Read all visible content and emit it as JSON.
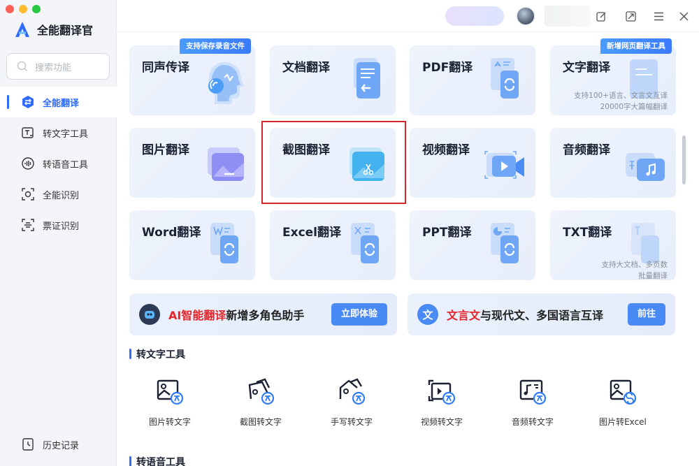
{
  "app": {
    "name": "全能翻译官",
    "brand_color": "#2f6bff"
  },
  "sidebar": {
    "search_placeholder": "搜索功能",
    "items": [
      {
        "label": "全能翻译",
        "icon": "translate-icon",
        "active": true
      },
      {
        "label": "转文字工具",
        "icon": "text-convert-icon"
      },
      {
        "label": "转语音工具",
        "icon": "voice-icon"
      },
      {
        "label": "全能识别",
        "icon": "scan-icon"
      },
      {
        "label": "票证识别",
        "icon": "receipt-scan-icon"
      }
    ],
    "history": "历史记录"
  },
  "cards": [
    {
      "title": "同声传译",
      "badge": "支持保存录音文件"
    },
    {
      "title": "文档翻译"
    },
    {
      "title": "PDF翻译"
    },
    {
      "title": "文字翻译",
      "badge": "新增网页翻译工具",
      "note": [
        "支持100+语言、文言文互译",
        "20000字大篇幅翻译"
      ]
    },
    {
      "title": "图片翻译"
    },
    {
      "title": "截图翻译"
    },
    {
      "title": "视频翻译"
    },
    {
      "title": "音频翻译"
    },
    {
      "title": "Word翻译"
    },
    {
      "title": "Excel翻译"
    },
    {
      "title": "PPT翻译"
    },
    {
      "title": "TXT翻译",
      "note": [
        "支持大文档、多页数",
        "批量翻译"
      ]
    }
  ],
  "promos": [
    {
      "highlight": "AI智能翻译",
      "text": "新增多角色助手",
      "button": "立即体验"
    },
    {
      "icon_text": "文",
      "highlight": "文言文",
      "text": "与现代文、多国语言互译",
      "button": "前往"
    }
  ],
  "sections": {
    "text_tools": "转文字工具",
    "voice_tools": "转语音工具"
  },
  "text_tools": [
    {
      "label": "图片转文字",
      "icon": "image-to-text-icon"
    },
    {
      "label": "截图转文字",
      "icon": "screenshot-to-text-icon"
    },
    {
      "label": "手写转文字",
      "icon": "handwriting-to-text-icon"
    },
    {
      "label": "视频转文字",
      "icon": "video-to-text-icon"
    },
    {
      "label": "音频转文字",
      "icon": "audio-to-text-icon"
    },
    {
      "label": "图片转Excel",
      "icon": "image-to-excel-icon"
    }
  ]
}
